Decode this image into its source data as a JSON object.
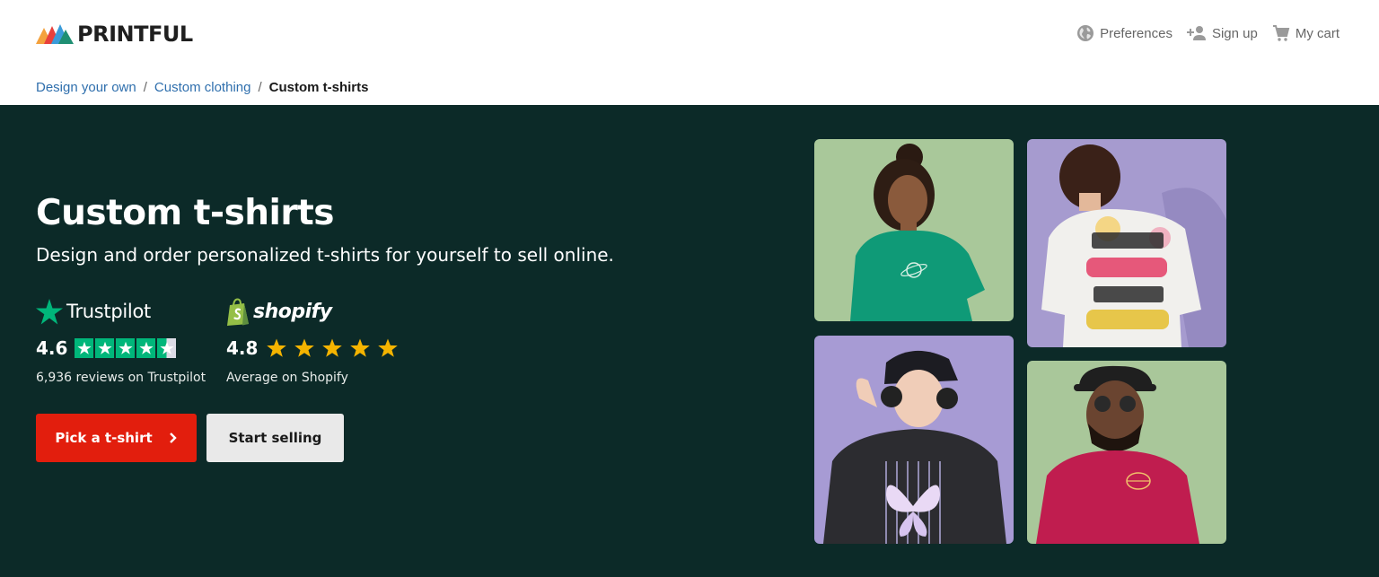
{
  "brand": {
    "name": "PRINTFUL"
  },
  "top_nav": [
    {
      "label": "Preferences",
      "icon": "globe-icon"
    },
    {
      "label": "Sign up",
      "icon": "add-user-icon"
    },
    {
      "label": "My cart",
      "icon": "cart-icon"
    }
  ],
  "breadcrumb": [
    {
      "label": "Design your own"
    },
    {
      "label": "Custom clothing"
    },
    {
      "label": "Custom t-shirts",
      "current": true
    }
  ],
  "breadcrumb_separator": "/",
  "hero": {
    "title": "Custom t-shirts",
    "subtitle": "Design and order personalized t-shirts for yourself to sell online.",
    "trustpilot": {
      "name": "Trustpilot",
      "score": "4.6",
      "stars": 4.5,
      "caption": "6,936 reviews on Trustpilot",
      "color": "#00b67a"
    },
    "shopify": {
      "name": "shopify",
      "score": "4.8",
      "stars": 5,
      "caption": "Average on Shopify",
      "star_color": "#f5b400"
    },
    "primary_button": {
      "label": "Pick a t-shirt",
      "color": "#e21e0d"
    },
    "secondary_button": {
      "label": "Start selling"
    },
    "background_color": "#0c2a28"
  },
  "photos": [
    {
      "subject": "woman in green t-shirt with planet print",
      "background": "#a9c89a",
      "shirt": "#0f9a77"
    },
    {
      "subject": "woman in white t-shirt with More miles More smiles back print",
      "background": "#a69bcf",
      "shirt": "#f1f0ed"
    },
    {
      "subject": "woman with headphones in black butterfly t-shirt",
      "background": "#a79bd4",
      "shirt": "#2c2c30"
    },
    {
      "subject": "man in magenta t-shirt with sunglasses",
      "background": "#a9c79a",
      "shirt": "#c01d4f"
    }
  ]
}
